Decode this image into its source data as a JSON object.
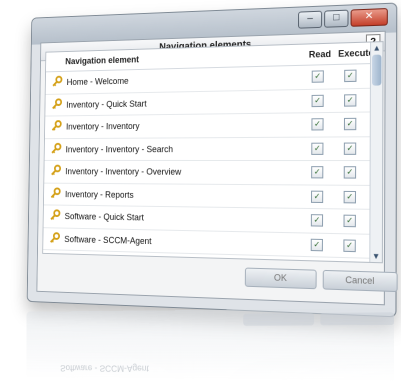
{
  "dialog": {
    "title": "Navigation elements",
    "help_label": "?"
  },
  "window_controls": {
    "minimize": "–",
    "maximize": "□",
    "close": "✕"
  },
  "table": {
    "columns": {
      "name": "Navigation element",
      "read": "Read",
      "execute": "Execute"
    },
    "rows": [
      {
        "label": "Home - Welcome",
        "read": true,
        "execute": true
      },
      {
        "label": "Inventory - Quick Start",
        "read": true,
        "execute": true
      },
      {
        "label": "Inventory - Inventory",
        "read": true,
        "execute": true
      },
      {
        "label": "Inventory - Inventory - Search",
        "read": true,
        "execute": true
      },
      {
        "label": "Inventory - Inventory - Overview",
        "read": true,
        "execute": true
      },
      {
        "label": "Inventory - Reports",
        "read": true,
        "execute": true
      },
      {
        "label": "Software - Quick Start",
        "read": true,
        "execute": true
      },
      {
        "label": "Software - SCCM-Agent",
        "read": true,
        "execute": true
      }
    ],
    "check_glyph": "✓",
    "row_icon": "key-icon"
  },
  "buttons": {
    "ok": "OK",
    "cancel": "Cancel"
  },
  "scrollbar": {
    "up": "▲",
    "down": "▼"
  },
  "reflection": {
    "text": "Software - SCCM-Agent"
  },
  "colors": {
    "key_icon": "#d4a017",
    "checkbox_check": "#2f6a2f",
    "close_button": "#c4402b"
  }
}
